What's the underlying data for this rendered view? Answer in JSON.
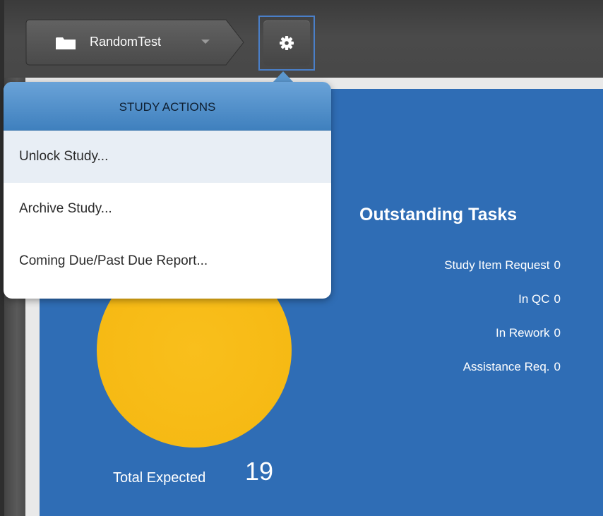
{
  "toolbar": {
    "study_name": "RandomTest"
  },
  "study_menu": {
    "header": "STUDY ACTIONS",
    "items": [
      {
        "label": "Unlock Study..."
      },
      {
        "label": "Archive Study..."
      },
      {
        "label": "Coming Due/Past Due Report..."
      }
    ]
  },
  "tasks": {
    "title": "Outstanding Tasks",
    "rows": [
      {
        "label": "Study Item Request",
        "count": "0"
      },
      {
        "label": "In QC",
        "count": "0"
      },
      {
        "label": "In Rework",
        "count": "0"
      },
      {
        "label": "Assistance Req.",
        "count": "0"
      }
    ]
  },
  "summary": {
    "total_label": "Total Expected",
    "total_value": "19"
  },
  "colors": {
    "dashboard_bg": "#2f6db5",
    "circle": "#f6b913",
    "menu_header": "#4f8dc8"
  }
}
